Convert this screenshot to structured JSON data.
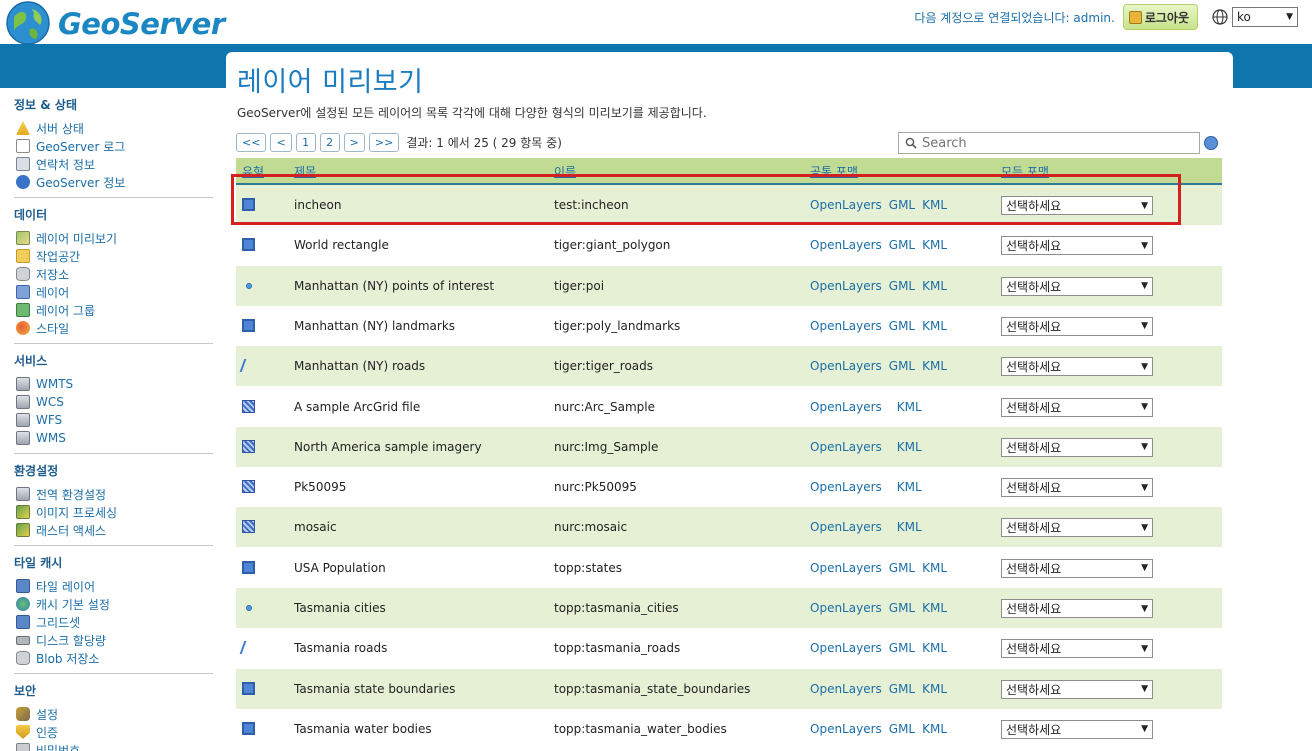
{
  "header": {
    "app_name": "GeoServer",
    "logged_in_text": "다음 계정으로 연결되었습니다: admin.",
    "logout_label": "로그아웃",
    "language": "ko"
  },
  "sidebar": {
    "sections": [
      {
        "title": "정보 & 상태",
        "items": [
          {
            "label": "서버 상태",
            "icon": "warning-icon"
          },
          {
            "label": "GeoServer 로그",
            "icon": "document-icon"
          },
          {
            "label": "연락처 정보",
            "icon": "contact-card-icon"
          },
          {
            "label": "GeoServer 정보",
            "icon": "info-icon"
          }
        ]
      },
      {
        "title": "데이터",
        "items": [
          {
            "label": "레이어 미리보기",
            "icon": "map-preview-icon"
          },
          {
            "label": "작업공간",
            "icon": "folder-icon"
          },
          {
            "label": "저장소",
            "icon": "database-icon"
          },
          {
            "label": "레이어",
            "icon": "layer-icon"
          },
          {
            "label": "레이어 그룹",
            "icon": "layer-group-icon"
          },
          {
            "label": "스타일",
            "icon": "palette-icon"
          }
        ]
      },
      {
        "title": "서비스",
        "items": [
          {
            "label": "WMTS",
            "icon": "server-icon"
          },
          {
            "label": "WCS",
            "icon": "server-icon"
          },
          {
            "label": "WFS",
            "icon": "server-icon"
          },
          {
            "label": "WMS",
            "icon": "server-icon"
          }
        ]
      },
      {
        "title": "환경설정",
        "items": [
          {
            "label": "전역 환경설정",
            "icon": "server-icon"
          },
          {
            "label": "이미지 프로세싱",
            "icon": "image-icon"
          },
          {
            "label": "래스터 액세스",
            "icon": "image-icon"
          }
        ]
      },
      {
        "title": "타일 캐시",
        "items": [
          {
            "label": "타일 레이어",
            "icon": "grid-icon"
          },
          {
            "label": "캐시 기본 설정",
            "icon": "globe-icon"
          },
          {
            "label": "그리드셋",
            "icon": "grid-icon"
          },
          {
            "label": "디스크 할당량",
            "icon": "disk-icon"
          },
          {
            "label": "Blob 저장소",
            "icon": "database-icon"
          }
        ]
      },
      {
        "title": "보안",
        "items": [
          {
            "label": "설정",
            "icon": "key-icon"
          },
          {
            "label": "인증",
            "icon": "shield-icon"
          },
          {
            "label": "비밀번호",
            "icon": "lock-icon"
          }
        ]
      }
    ]
  },
  "main": {
    "title": "레이어 미리보기",
    "description": "GeoServer에 설정된 모든 레이어의 목록 각각에 대해 다양한 형식의 미리보기를 제공합니다.",
    "pager": {
      "first": "<<",
      "prev": "<",
      "page1": "1",
      "page2": "2",
      "next": ">",
      "last": ">>",
      "info": "결과: 1 에서 25 ( 29 항목 중)"
    },
    "search_placeholder": "Search",
    "columns": {
      "type": "유형",
      "title": "제목",
      "name": "이름",
      "common_formats": "공통 포맷",
      "all_formats": "모든 포맷"
    },
    "select_label": "선택하세요",
    "rows": [
      {
        "type": "polygon",
        "title": "incheon",
        "name": "test:incheon",
        "formats": [
          "OpenLayers",
          "GML",
          "KML"
        ]
      },
      {
        "type": "polygon",
        "title": "World rectangle",
        "name": "tiger:giant_polygon",
        "formats": [
          "OpenLayers",
          "GML",
          "KML"
        ]
      },
      {
        "type": "point",
        "title": "Manhattan (NY) points of interest",
        "name": "tiger:poi",
        "formats": [
          "OpenLayers",
          "GML",
          "KML"
        ]
      },
      {
        "type": "polygon",
        "title": "Manhattan (NY) landmarks",
        "name": "tiger:poly_landmarks",
        "formats": [
          "OpenLayers",
          "GML",
          "KML"
        ]
      },
      {
        "type": "line",
        "title": "Manhattan (NY) roads",
        "name": "tiger:tiger_roads",
        "formats": [
          "OpenLayers",
          "GML",
          "KML"
        ]
      },
      {
        "type": "raster",
        "title": "A sample ArcGrid file",
        "name": "nurc:Arc_Sample",
        "formats": [
          "OpenLayers",
          "KML"
        ]
      },
      {
        "type": "raster",
        "title": "North America sample imagery",
        "name": "nurc:Img_Sample",
        "formats": [
          "OpenLayers",
          "KML"
        ]
      },
      {
        "type": "raster",
        "title": "Pk50095",
        "name": "nurc:Pk50095",
        "formats": [
          "OpenLayers",
          "KML"
        ]
      },
      {
        "type": "raster",
        "title": "mosaic",
        "name": "nurc:mosaic",
        "formats": [
          "OpenLayers",
          "KML"
        ]
      },
      {
        "type": "polygon",
        "title": "USA Population",
        "name": "topp:states",
        "formats": [
          "OpenLayers",
          "GML",
          "KML"
        ]
      },
      {
        "type": "point",
        "title": "Tasmania cities",
        "name": "topp:tasmania_cities",
        "formats": [
          "OpenLayers",
          "GML",
          "KML"
        ]
      },
      {
        "type": "line",
        "title": "Tasmania roads",
        "name": "topp:tasmania_roads",
        "formats": [
          "OpenLayers",
          "GML",
          "KML"
        ]
      },
      {
        "type": "polygon",
        "title": "Tasmania state boundaries",
        "name": "topp:tasmania_state_boundaries",
        "formats": [
          "OpenLayers",
          "GML",
          "KML"
        ]
      },
      {
        "type": "polygon",
        "title": "Tasmania water bodies",
        "name": "topp:tasmania_water_bodies",
        "formats": [
          "OpenLayers",
          "GML",
          "KML"
        ]
      }
    ]
  },
  "colors": {
    "accent": "#1b7cbf",
    "header_band": "#0e76ad",
    "row_alt": "#e5f0d5",
    "table_header": "#c1db92",
    "highlight": "#d42020"
  }
}
